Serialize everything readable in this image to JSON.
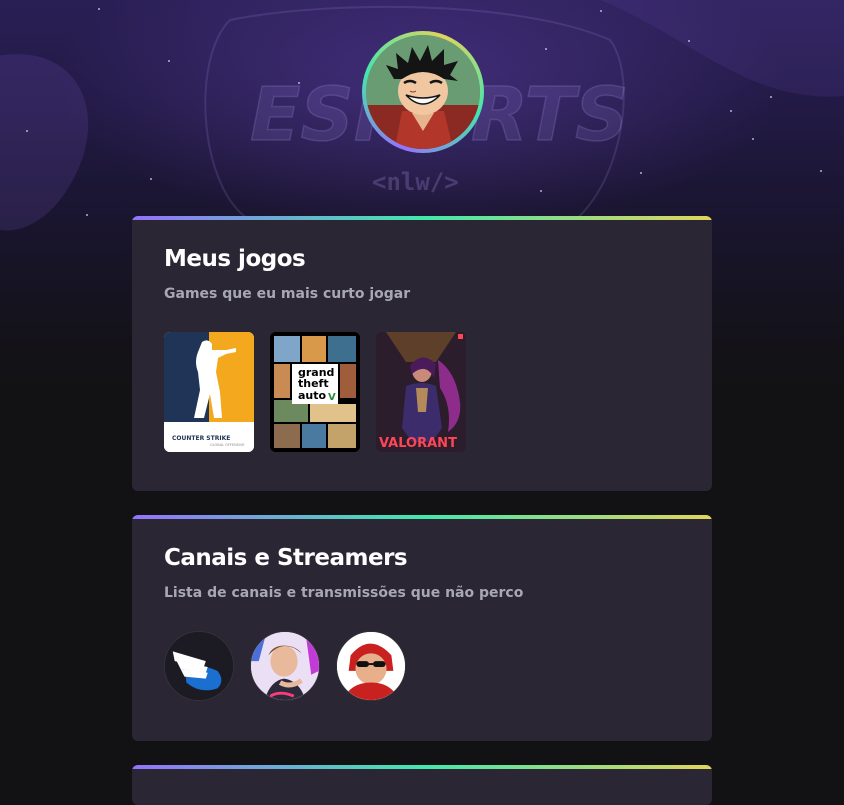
{
  "profile": {
    "avatar_icon": "luffy-avatar-icon",
    "ring_colors": [
      "#9572FC",
      "#43E7AD",
      "#E2D45C"
    ],
    "bg_logo_text": "ESPORTS",
    "bg_logo_sub": "<nlw/>"
  },
  "sections": [
    {
      "title": "Meus jogos",
      "subtitle": "Games que eu mais curto jogar",
      "games": [
        {
          "name": "counter-strike",
          "label": "COUNTER STRIKE",
          "sub": "GLOBAL OFFENSIVE"
        },
        {
          "name": "gta-v",
          "label_1": "grand",
          "label_2": "theft",
          "label_3": "auto",
          "label_4": "V"
        },
        {
          "name": "valorant",
          "label": "VALORANT"
        }
      ]
    },
    {
      "title": "Canais e Streamers",
      "subtitle": "Lista de canais e transmissões que não perco",
      "channels": [
        {
          "name": "winged-channel"
        },
        {
          "name": "streamer-2"
        },
        {
          "name": "streamer-3"
        }
      ]
    },
    {
      "title": ""
    }
  ],
  "colors": {
    "card_bg": "#2A2634",
    "page_bg": "#121214",
    "title": "#FFFFFF",
    "subtitle": "#A8A8B3",
    "gradient": [
      "#9572FC",
      "#43E7AD",
      "#E2D45C"
    ]
  }
}
